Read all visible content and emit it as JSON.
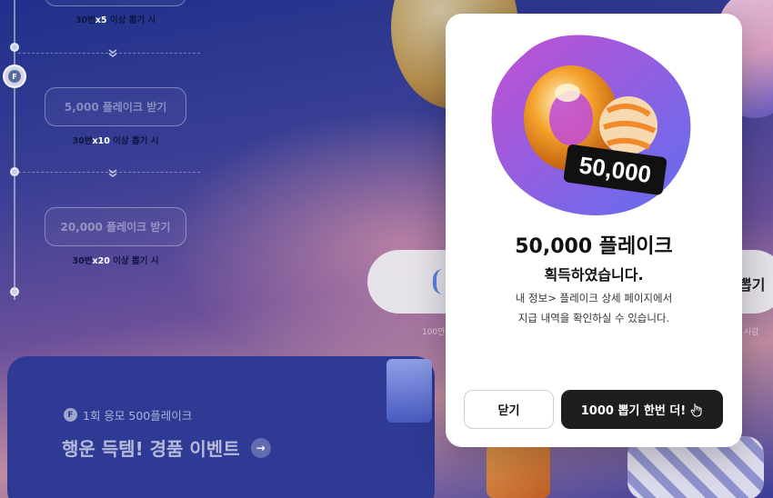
{
  "background": {
    "steps": [
      {
        "button_label": "",
        "cond_prefix": "30번",
        "cond_mult": "x5",
        "cond_suffix": " 이상 뽑기 시"
      },
      {
        "button_label": "5,000 플레이크 받기",
        "cond_prefix": "30번",
        "cond_mult": "x10",
        "cond_suffix": " 이상 뽑기 시"
      },
      {
        "button_label": "20,000 플레이크 받기",
        "cond_prefix": "30번",
        "cond_mult": "x20",
        "cond_suffix": " 이상 뽑기 시"
      }
    ],
    "timeline_badge": "F",
    "event": {
      "badge": "F",
      "subtitle": "1회 응모 500플레이크",
      "title": "행운 득템! 경품 이벤트",
      "arrow": "→"
    },
    "pill_text": "뽑기",
    "small_left": "100만",
    "small_right": "사감"
  },
  "modal": {
    "badge_amount": "50,000",
    "title": "50,000 플레이크",
    "subtitle": "획득하였습니다.",
    "desc_line1": "내 정보> 플레이크 상세 페이지에서",
    "desc_line2": "지급 내역을 확인하실 수 있습니다.",
    "close_label": "닫기",
    "again_label": "1000 뽑기 한번 더!"
  },
  "colors": {
    "modal_bg": "#ffffff",
    "primary_button": "#1e1e1e",
    "blob_start": "#b44fd6",
    "blob_end": "#6a6cf0",
    "event_banner": "#2e3a94"
  },
  "icons": [
    "chevron-down-icon",
    "flake-icon",
    "arrow-right-icon",
    "hand-pointer-icon"
  ]
}
